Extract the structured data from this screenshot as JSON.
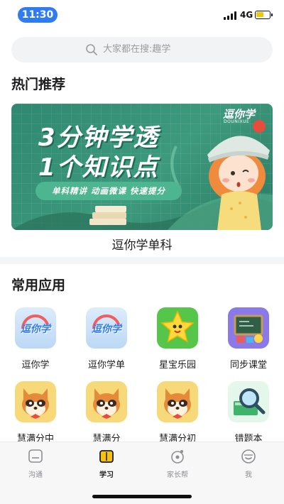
{
  "status_bar": {
    "time": "11:30",
    "network": "4G"
  },
  "search": {
    "placeholder": "大家都在搜:趣学"
  },
  "hot": {
    "title": "热门推荐",
    "banner": {
      "headline_1": "3分钟学透",
      "headline_2": "1个知识点",
      "tagline": "单科精讲 动画微课 快速提分",
      "logo": "逗你学",
      "logo_sub": "DOUNIXUE",
      "page_count": 3,
      "active_page": 1
    },
    "caption": "逗你学单科"
  },
  "apps": {
    "title": "常用应用",
    "items": [
      {
        "label": "逗你学",
        "icon": "dounixue-icon",
        "icon_text": "逗你学"
      },
      {
        "label": "逗你学单",
        "icon": "dounixue-single-icon",
        "icon_text": "逗你学"
      },
      {
        "label": "星宝乐园",
        "icon": "star-icon"
      },
      {
        "label": "同步课堂",
        "icon": "classroom-icon"
      },
      {
        "label": "慧满分中",
        "icon": "fox-icon"
      },
      {
        "label": "慧满分",
        "icon": "fox-icon"
      },
      {
        "label": "慧满分初",
        "icon": "fox-icon"
      },
      {
        "label": "错题本",
        "icon": "magnifier-book-icon"
      }
    ]
  },
  "tabbar": {
    "items": [
      {
        "label": "沟通",
        "icon": "chat-icon"
      },
      {
        "label": "学习",
        "icon": "book-icon"
      },
      {
        "label": "家长帮",
        "icon": "helper-icon"
      },
      {
        "label": "我",
        "icon": "profile-icon"
      }
    ],
    "active_index": 1
  },
  "colors": {
    "accent": "#2f7bf1",
    "banner": "#3d9a7d"
  }
}
